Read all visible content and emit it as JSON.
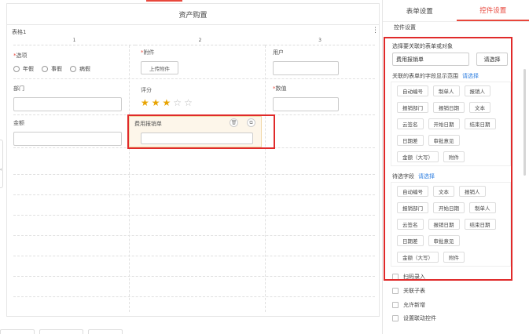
{
  "canvas": {
    "title": "资产购置",
    "table_name": "表格1",
    "columns": [
      "1",
      "2",
      "3"
    ],
    "more_icon": "vertical-dots-icon"
  },
  "fields": {
    "option": {
      "label": "选项",
      "required": true,
      "options": [
        "年假",
        "事假",
        "病假"
      ]
    },
    "attachment": {
      "label": "附件",
      "required": true,
      "button": "上传附件"
    },
    "user": {
      "label": "用户"
    },
    "department": {
      "label": "部门"
    },
    "rating": {
      "label": "评分",
      "value": 3,
      "max": 5
    },
    "number": {
      "label": "数值",
      "required": true
    },
    "amount": {
      "label": "金额"
    },
    "expense": {
      "label": "费用报销单"
    }
  },
  "panel": {
    "tabs": [
      "表单设置",
      "控件设置"
    ],
    "active_tab": 1,
    "section_title": "控件设置",
    "object_label": "选择要关联的表单或对象",
    "object_value": "费用报销单",
    "choose_button": "请选择",
    "display_label": "关联的表单的字段显示范围",
    "display_link": "请选择",
    "display_tags": [
      "自动编号",
      "制单人",
      "报销人",
      "报销部门",
      "报销日期",
      "文本",
      "云签名",
      "开始日期",
      "结束日期",
      "日期差",
      "审批意见",
      "金额（大写）",
      "附件"
    ],
    "candidate_label": "待选字段",
    "candidate_link": "请选择",
    "candidate_tags": [
      "自动编号",
      "文本",
      "报销人",
      "报销部门",
      "开始日期",
      "制单人",
      "云签名",
      "报销日期",
      "结束日期",
      "日期差",
      "审批意见",
      "金额（大写）",
      "附件"
    ],
    "checkboxes": [
      "扫码录入",
      "关联子表",
      "允许新增",
      "设置联动控件"
    ]
  },
  "colors": {
    "accent": "#e8473c",
    "link": "#2f7fe0",
    "highlight_box": "#e02a2a",
    "star": "#e8a300"
  }
}
